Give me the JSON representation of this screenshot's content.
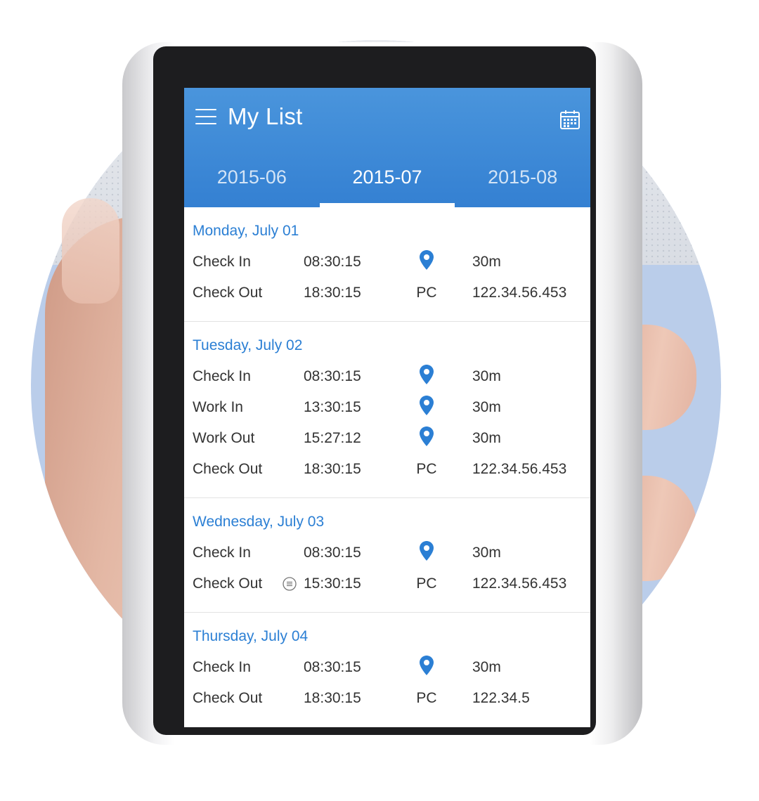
{
  "app": {
    "title": "My List"
  },
  "tabs": [
    {
      "label": "2015-06",
      "active": false
    },
    {
      "label": "2015-07",
      "active": true
    },
    {
      "label": "2015-08",
      "active": false
    }
  ],
  "days": [
    {
      "date": "Monday, July 01",
      "entries": [
        {
          "label": "Check In",
          "time": "08:30:15",
          "source": "location-pin-icon",
          "value": "30m"
        },
        {
          "label": "Check Out",
          "time": "18:30:15",
          "source_text": "PC",
          "value": "122.34.56.453"
        }
      ]
    },
    {
      "date": "Tuesday, July 02",
      "entries": [
        {
          "label": "Check In",
          "time": "08:30:15",
          "source": "location-pin-icon",
          "value": "30m"
        },
        {
          "label": "Work In",
          "time": "13:30:15",
          "source": "location-pin-icon",
          "value": "30m"
        },
        {
          "label": "Work Out",
          "time": "15:27:12",
          "source": "location-pin-icon",
          "value": "30m"
        },
        {
          "label": "Check Out",
          "time": "18:30:15",
          "source_text": "PC",
          "value": "122.34.56.453"
        }
      ]
    },
    {
      "date": "Wednesday, July 03",
      "entries": [
        {
          "label": "Check In",
          "time": "08:30:15",
          "source": "location-pin-icon",
          "value": "30m"
        },
        {
          "label": "Check Out",
          "time": "15:30:15",
          "source_text": "PC",
          "value": "122.34.56.453",
          "note": "note-icon"
        }
      ]
    },
    {
      "date": "Thursday, July 04",
      "entries": [
        {
          "label": "Check In",
          "time": "08:30:15",
          "source": "location-pin-icon",
          "value": "30m"
        },
        {
          "label": "Check Out",
          "time": "18:30:15",
          "source_text": "PC",
          "value": "122.34.5"
        }
      ]
    }
  ],
  "colors": {
    "accent": "#3480d2",
    "date_text": "#2b7fd4",
    "background_circle": "#bacdea"
  }
}
